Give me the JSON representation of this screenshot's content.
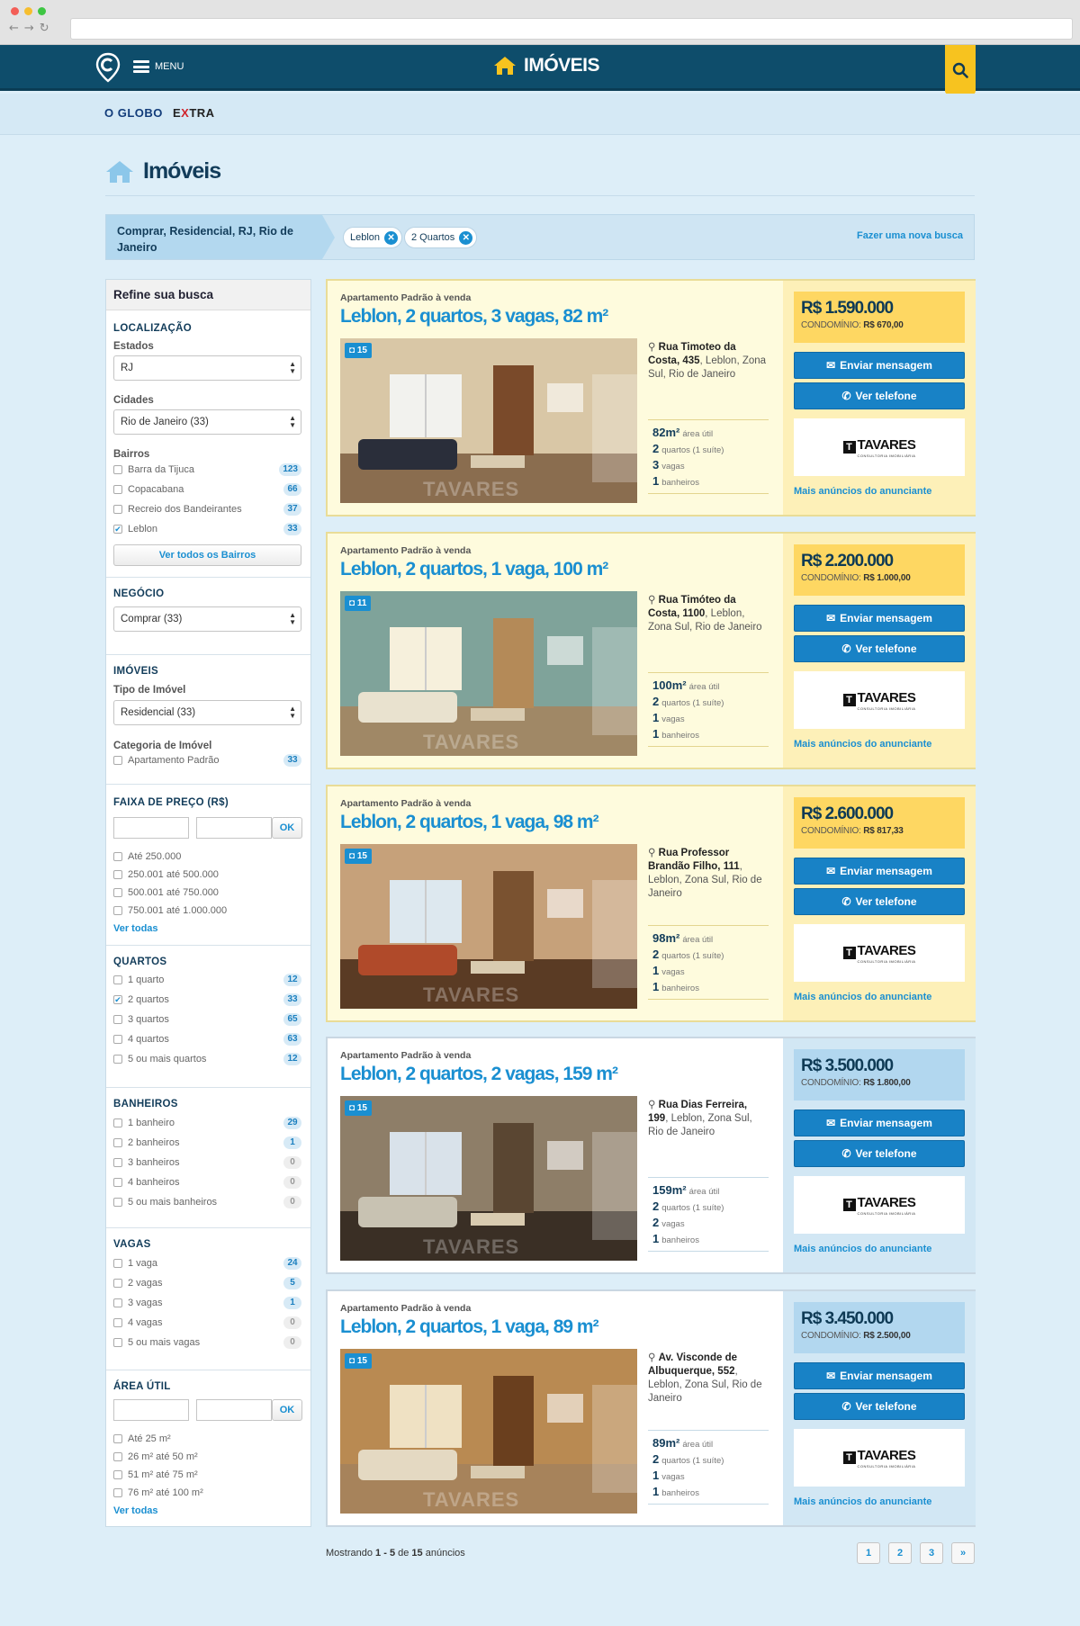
{
  "header": {
    "menu_label": "MENU",
    "section": "IMÓVEIS"
  },
  "partners": {
    "oglobo": "O GLOBO",
    "extra_a": "E",
    "extra_b": "X",
    "extra_c": "TRA"
  },
  "page": {
    "title": "Imóveis"
  },
  "search": {
    "summary": "Comprar, Residencial, RJ, Rio de Janeiro",
    "chips": [
      "Leblon",
      "2 Quartos"
    ],
    "new_search": "Fazer uma nova busca"
  },
  "sidebar": {
    "title": "Refine sua busca",
    "localizacao": {
      "title": "LOCALIZAÇÃO",
      "estados_label": "Estados",
      "estados_value": "RJ",
      "cidades_label": "Cidades",
      "cidades_value": "Rio de Janeiro (33)",
      "bairros_label": "Bairros",
      "bairros": [
        {
          "label": "Barra da Tijuca",
          "count": "123",
          "checked": false
        },
        {
          "label": "Copacabana",
          "count": "66",
          "checked": false
        },
        {
          "label": "Recreio dos Bandeirantes",
          "count": "37",
          "checked": false
        },
        {
          "label": "Leblon",
          "count": "33",
          "checked": true
        }
      ],
      "all_bairros": "Ver todos os Bairros"
    },
    "negocio": {
      "title": "NEGÓCIO",
      "value": "Comprar (33)"
    },
    "imoveis": {
      "title": "IMÓVEIS",
      "tipo_label": "Tipo de Imóvel",
      "tipo_value": "Residencial (33)",
      "categoria_label": "Categoria de Imóvel",
      "categoria": {
        "label": "Apartamento Padrão",
        "count": "33"
      }
    },
    "preco": {
      "title": "FAIXA DE PREÇO (R$)",
      "ok": "OK",
      "options": [
        "Até 250.000",
        "250.001 até 500.000",
        "500.001 até 750.000",
        "750.001 até 1.000.000"
      ],
      "see_all": "Ver todas"
    },
    "quartos": {
      "title": "QUARTOS",
      "options": [
        {
          "label": "1 quarto",
          "count": "12",
          "checked": false
        },
        {
          "label": "2 quartos",
          "count": "33",
          "checked": true
        },
        {
          "label": "3 quartos",
          "count": "65",
          "checked": false
        },
        {
          "label": "4 quartos",
          "count": "63",
          "checked": false
        },
        {
          "label": "5 ou mais quartos",
          "count": "12",
          "checked": false
        }
      ]
    },
    "banheiros": {
      "title": "BANHEIROS",
      "options": [
        {
          "label": "1 banheiro",
          "count": "29"
        },
        {
          "label": "2 banheiros",
          "count": "1"
        },
        {
          "label": "3 banheiros",
          "count": "0"
        },
        {
          "label": "4 banheiros",
          "count": "0"
        },
        {
          "label": "5 ou mais banheiros",
          "count": "0"
        }
      ]
    },
    "vagas": {
      "title": "VAGAS",
      "options": [
        {
          "label": "1 vaga",
          "count": "24"
        },
        {
          "label": "2 vagas",
          "count": "5"
        },
        {
          "label": "3 vagas",
          "count": "1"
        },
        {
          "label": "4 vagas",
          "count": "0"
        },
        {
          "label": "5 ou mais vagas",
          "count": "0"
        }
      ]
    },
    "area": {
      "title": "ÁREA ÚTIL",
      "ok": "OK",
      "options": [
        "Até 25 m²",
        "26 m² até 50 m²",
        "51 m² até 75 m²",
        "76 m² até 100 m²"
      ],
      "see_all": "Ver todas"
    }
  },
  "listings": [
    {
      "type": "Apartamento Padrão à venda",
      "title": "Leblon, 2 quartos, 3 vagas, 82 m²",
      "photos": "15",
      "street": "Rua Timoteo da Costa, 435",
      "area_text": ", Leblon, Zona Sul, Rio de Janeiro",
      "area_m2": "82m²",
      "area_label": "área útil",
      "quartos": "2",
      "quartos_label": "quartos (1 suíte)",
      "vagas": "3",
      "vagas_label": "vagas",
      "banheiros": "1",
      "banheiros_label": "banheiros",
      "price": "R$ 1.590.000",
      "condo_label": "CONDOMÍNIO:",
      "condo": "R$ 670,00",
      "msg": "Enviar mensagem",
      "tel": "Ver telefone",
      "advertiser": "TAVARES",
      "advertiser_tag": "CONSULTORIA IMOBILIÁRIA",
      "more": "Mais anúncios do anunciante",
      "highlight": true
    },
    {
      "type": "Apartamento Padrão à venda",
      "title": "Leblon, 2 quartos, 1 vaga, 100 m²",
      "photos": "11",
      "street": "Rua Timóteo da Costa, 1100",
      "area_text": ", Leblon, Zona Sul, Rio de Janeiro",
      "area_m2": "100m²",
      "area_label": "área útil",
      "quartos": "2",
      "quartos_label": "quartos (1 suíte)",
      "vagas": "1",
      "vagas_label": "vagas",
      "banheiros": "1",
      "banheiros_label": "banheiros",
      "price": "R$ 2.200.000",
      "condo_label": "CONDOMÍNIO:",
      "condo": "R$ 1.000,00",
      "msg": "Enviar mensagem",
      "tel": "Ver telefone",
      "advertiser": "TAVARES",
      "advertiser_tag": "CONSULTORIA IMOBILIÁRIA",
      "more": "Mais anúncios do anunciante",
      "highlight": true
    },
    {
      "type": "Apartamento Padrão à venda",
      "title": "Leblon, 2 quartos, 1 vaga, 98 m²",
      "photos": "15",
      "street": "Rua Professor Brandão Filho, 111",
      "area_text": ", Leblon, Zona Sul, Rio de Janeiro",
      "area_m2": "98m²",
      "area_label": "área útil",
      "quartos": "2",
      "quartos_label": "quartos (1 suíte)",
      "vagas": "1",
      "vagas_label": "vagas",
      "banheiros": "1",
      "banheiros_label": "banheiros",
      "price": "R$ 2.600.000",
      "condo_label": "CONDOMÍNIO:",
      "condo": "R$ 817,33",
      "msg": "Enviar mensagem",
      "tel": "Ver telefone",
      "advertiser": "TAVARES",
      "advertiser_tag": "CONSULTORIA IMOBILIÁRIA",
      "more": "Mais anúncios do anunciante",
      "highlight": true
    },
    {
      "type": "Apartamento Padrão à venda",
      "title": "Leblon, 2 quartos, 2 vagas, 159 m²",
      "photos": "15",
      "street": "Rua Dias Ferreira, 199",
      "area_text": ", Leblon, Zona Sul, Rio de Janeiro",
      "area_m2": "159m²",
      "area_label": "área útil",
      "quartos": "2",
      "quartos_label": "quartos (1 suíte)",
      "vagas": "2",
      "vagas_label": "vagas",
      "banheiros": "1",
      "banheiros_label": "banheiros",
      "price": "R$ 3.500.000",
      "condo_label": "CONDOMÍNIO:",
      "condo": "R$ 1.800,00",
      "msg": "Enviar mensagem",
      "tel": "Ver telefone",
      "advertiser": "TAVARES",
      "advertiser_tag": "CONSULTORIA IMOBILIÁRIA",
      "more": "Mais anúncios do anunciante",
      "highlight": false
    },
    {
      "type": "Apartamento Padrão à venda",
      "title": "Leblon, 2 quartos, 1 vaga, 89 m²",
      "photos": "15",
      "street": "Av. Visconde de Albuquerque, 552",
      "area_text": ", Leblon, Zona Sul, Rio de Janeiro",
      "area_m2": "89m²",
      "area_label": "área útil",
      "quartos": "2",
      "quartos_label": "quartos (1 suíte)",
      "vagas": "1",
      "vagas_label": "vagas",
      "banheiros": "1",
      "banheiros_label": "banheiros",
      "price": "R$ 3.450.000",
      "condo_label": "CONDOMÍNIO:",
      "condo": "R$ 2.500,00",
      "msg": "Enviar mensagem",
      "tel": "Ver telefone",
      "advertiser": "TAVARES",
      "advertiser_tag": "CONSULTORIA IMOBILIÁRIA",
      "more": "Mais anúncios do anunciante",
      "highlight": false
    }
  ],
  "pagination": {
    "prefix": "Mostrando ",
    "from": "1",
    "sep": " - ",
    "to": "5",
    "of": " de ",
    "total": "15",
    "suffix": " anúncios",
    "pages": [
      "1",
      "2",
      "3",
      "»"
    ]
  },
  "colors": {
    "topbar": "#0e4d6b",
    "accent": "#1a8fd1",
    "highlight_price": "#fed762",
    "standard_price": "#b2d7ef"
  }
}
